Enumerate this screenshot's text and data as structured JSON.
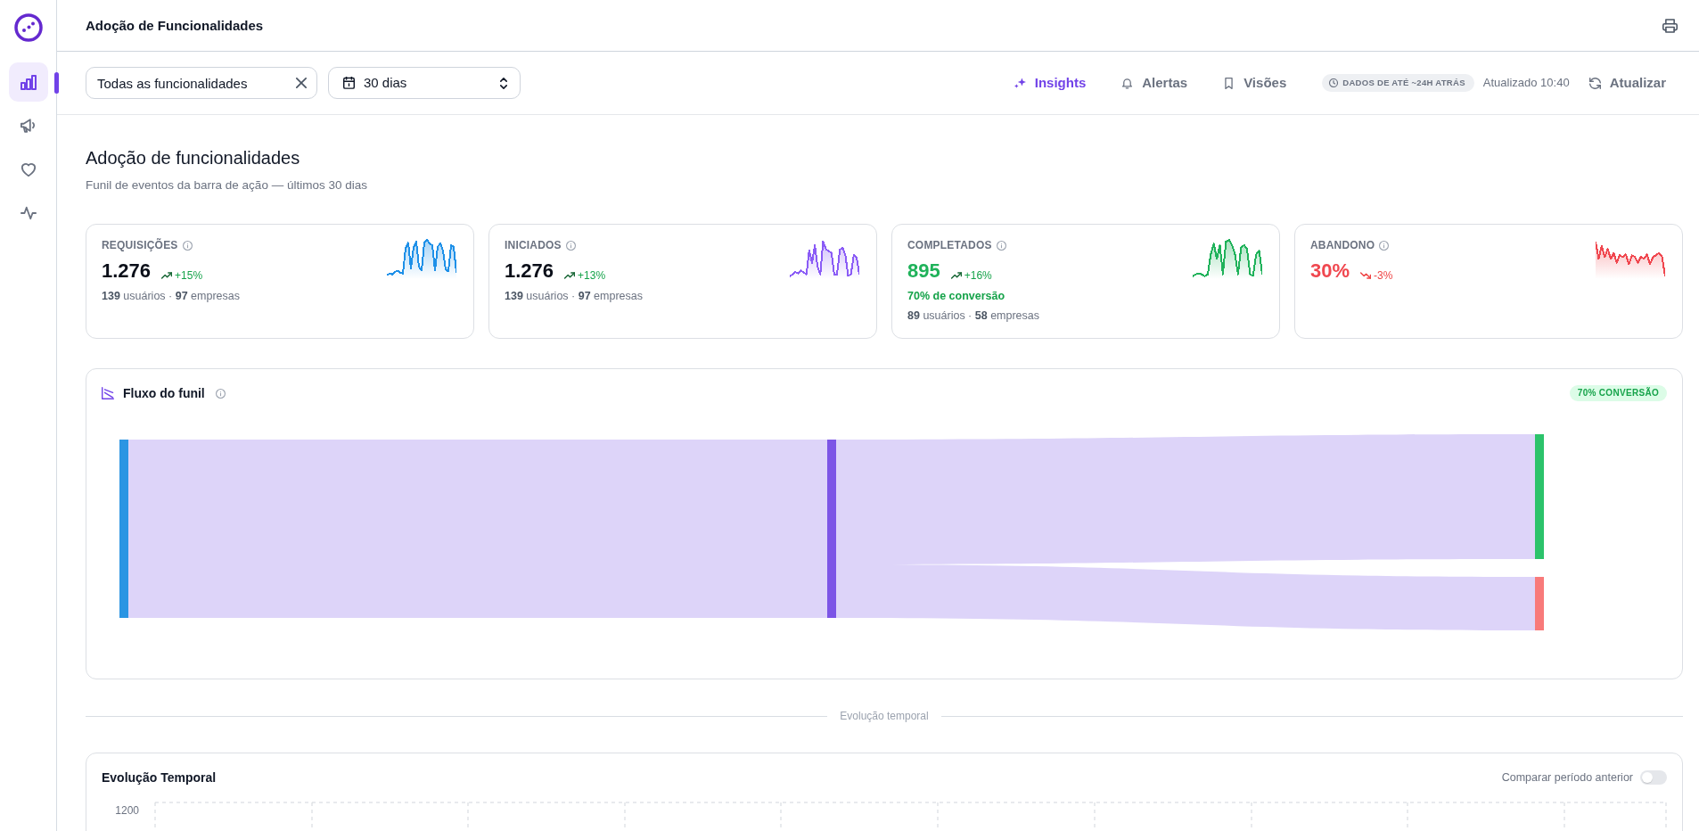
{
  "sidebar": {
    "items": [
      {
        "selected": true
      },
      {
        "selected": false
      },
      {
        "selected": false
      },
      {
        "selected": false
      }
    ]
  },
  "header": {
    "title": "Adoção de Funcionalidades"
  },
  "filters": {
    "feature": {
      "value": "Todas as funcionalidades"
    },
    "period": {
      "value": "30 dias"
    }
  },
  "toolbar": {
    "tabs": [
      {
        "label": "Insights",
        "selected": true
      },
      {
        "label": "Alertas",
        "selected": false
      },
      {
        "label": "Visões",
        "selected": false
      }
    ],
    "freshness_badge": "DADOS DE ATÉ ~24H ATRÁS",
    "updated": "Atualizado 10:40",
    "refresh": "Atualizar"
  },
  "page": {
    "title": "Adoção de funcionalidades",
    "subtitle": "Funil de eventos da barra de ação — últimos 30 dias"
  },
  "metrics": [
    {
      "label": "REQUISIÇÕES",
      "value": "1.276",
      "value_colored": false,
      "color": "#1e90e8",
      "trend": {
        "kind": "up",
        "text": "+15%"
      },
      "lines": [
        {
          "kind": "meta",
          "text": "**139** usuários · **97** empresas"
        }
      ]
    },
    {
      "label": "INICIADOS",
      "value": "1.276",
      "value_colored": false,
      "color": "#8b5cf6",
      "trend": {
        "kind": "up",
        "text": "+13%"
      },
      "lines": [
        {
          "kind": "meta",
          "text": "**139** usuários · **97** empresas"
        }
      ]
    },
    {
      "label": "COMPLETADOS",
      "value": "895",
      "value_colored": true,
      "color": "#1fb25a",
      "trend": {
        "kind": "up",
        "text": "+16%"
      },
      "lines": [
        {
          "kind": "conversion",
          "text": "70% de conversão"
        },
        {
          "kind": "meta",
          "text": "**89** usuários · **58** empresas"
        }
      ]
    },
    {
      "label": "ABANDONO",
      "value": "30%",
      "value_colored": true,
      "color": "#f0474f",
      "trend": {
        "kind": "down",
        "text": "-3%"
      }
    }
  ],
  "funnel": {
    "title": "Fluxo do funil",
    "badge": "70% CONVERSÃO"
  },
  "section_divider": "Evolução temporal",
  "evolution": {
    "title": "Evolução Temporal",
    "compare": {
      "label": "Comparar período anterior",
      "on": false
    },
    "y_tick_labels": [
      "1200"
    ]
  }
}
